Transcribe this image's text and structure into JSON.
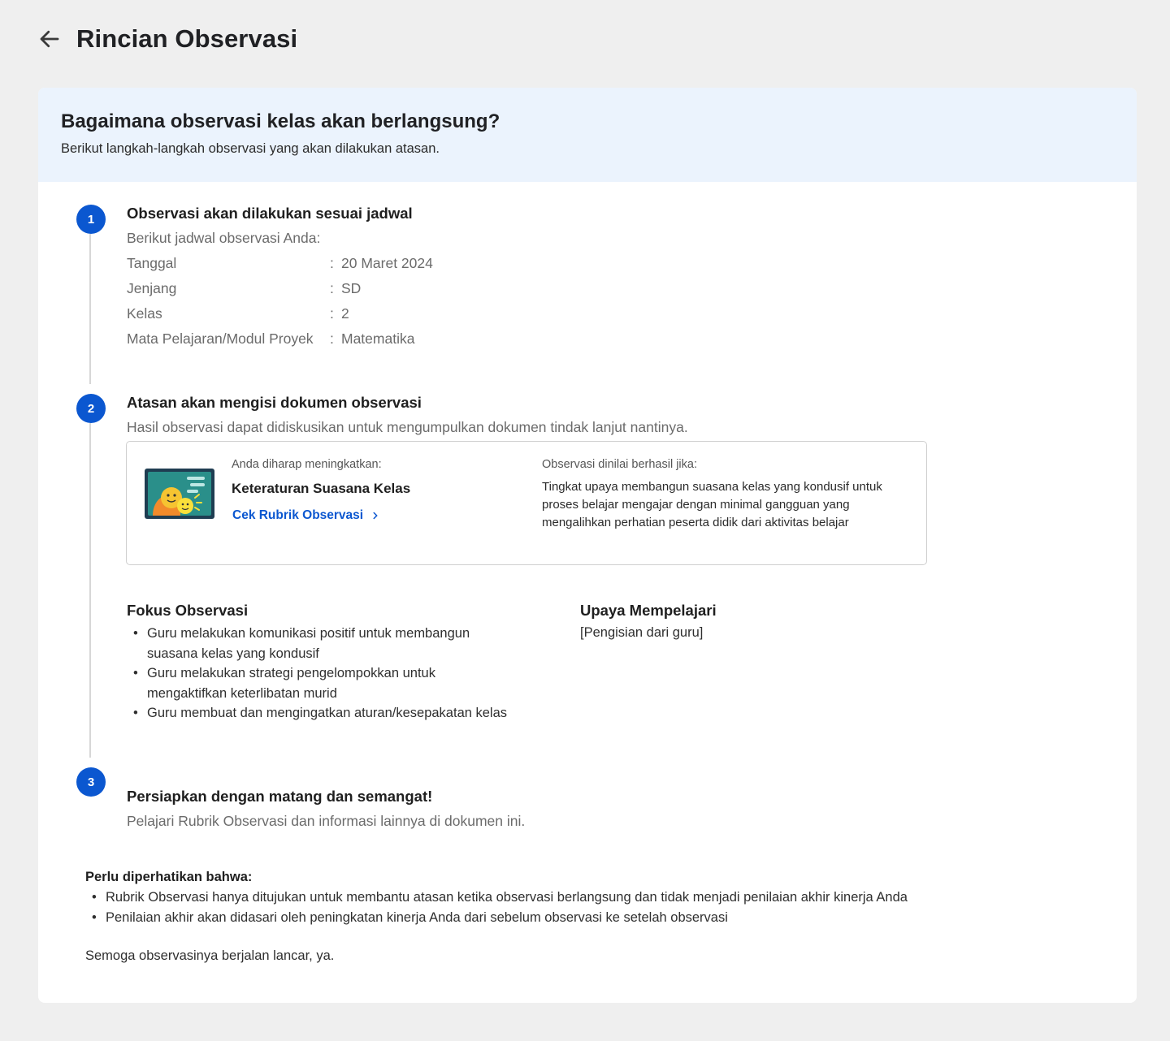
{
  "header": {
    "title": "Rincian Observasi",
    "back_icon": "arrow-left-icon"
  },
  "banner": {
    "title": "Bagaimana observasi kelas akan berlangsung?",
    "subtitle": "Berikut langkah-langkah observasi yang akan dilakukan atasan."
  },
  "steps": [
    {
      "number": "1",
      "title": "Observasi akan dilakukan sesuai jadwal",
      "intro": "Berikut jadwal observasi Anda:",
      "schedule": [
        {
          "label": "Tanggal",
          "value": "20 Maret 2024"
        },
        {
          "label": "Jenjang",
          "value": "SD"
        },
        {
          "label": "Kelas",
          "value": "2"
        },
        {
          "label": "Mata Pelajaran/Modul Proyek",
          "value": "Matematika"
        }
      ]
    },
    {
      "number": "2",
      "title": "Atasan akan mengisi dokumen observasi",
      "description": "Hasil observasi dapat didiskusikan untuk mengumpulkan dokumen tindak lanjut nantinya.",
      "focus_card": {
        "improve_label": "Anda diharap meningkatkan:",
        "improve_value": "Keteraturan Suasana Kelas",
        "link_label": "Cek Rubrik Observasi",
        "success_label": "Observasi dinilai berhasil jika:",
        "success_text": "Tingkat upaya membangun suasana kelas yang kondusif untuk proses belajar mengajar dengan minimal gangguan yang mengalihkan perhatian peserta didik dari aktivitas belajar"
      },
      "focus_title": "Fokus Observasi",
      "focus_items": [
        "Guru melakukan komunikasi positif untuk membangun suasana kelas yang kondusif",
        "Guru melakukan strategi pengelompokkan untuk mengaktifkan keterlibatan murid",
        "Guru membuat dan mengingatkan aturan/kesepakatan kelas"
      ],
      "effort_title": "Upaya Mempelajari",
      "effort_text": "[Pengisian dari guru]"
    },
    {
      "number": "3",
      "title": "Persiapkan dengan matang dan semangat!",
      "description": "Pelajari Rubrik Observasi dan informasi lainnya di dokumen ini."
    }
  ],
  "note": {
    "title": "Perlu diperhatikan bahwa:",
    "items": [
      "Rubrik Observasi hanya ditujukan untuk membantu atasan ketika observasi berlangsung dan tidak menjadi penilaian akhir kinerja Anda",
      "Penilaian akhir akan didasari oleh peningkatan kinerja Anda dari sebelum observasi ke setelah observasi"
    ]
  },
  "closing": "Semoga observasinya berjalan lancar, ya.",
  "colors": {
    "accent": "#0b57d0",
    "banner_bg": "#ebf3fd",
    "page_bg": "#efefef"
  }
}
